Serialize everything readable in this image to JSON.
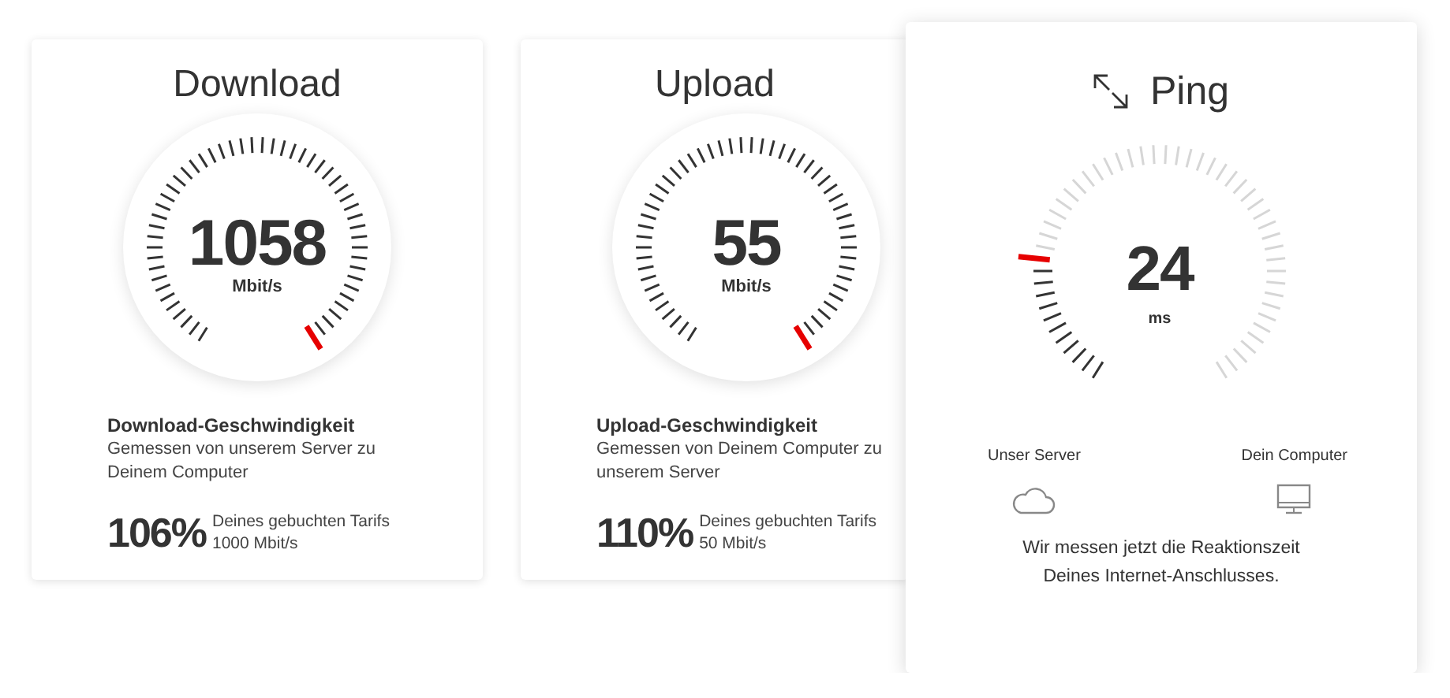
{
  "cards": [
    {
      "kind": "speed",
      "title": "Download",
      "gauge": {
        "value": "1058",
        "unit": "Mbit/s"
      },
      "heading": "Download-Geschwindigkeit",
      "description": "Gemessen von unserem Server zu Deinem Computer",
      "percent": "106%",
      "tariff_label": "Deines gebuchten Tarifs",
      "tariff_speed": "1000 Mbit/s"
    },
    {
      "kind": "speed",
      "title": "Upload",
      "gauge": {
        "value": "55",
        "unit": "Mbit/s"
      },
      "heading": "Upload-Geschwindigkeit",
      "description": "Gemessen von Deinem Computer zu unserem Server",
      "percent": "110%",
      "tariff_label": "Deines gebuchten Tarifs",
      "tariff_speed": "50 Mbit/s"
    },
    {
      "kind": "latency",
      "title": "Ping",
      "gauge": {
        "value": "24",
        "unit": "ms"
      },
      "endpoints": [
        {
          "label": "Unser Server",
          "kind": "cloud"
        },
        {
          "label": "Dein Computer",
          "kind": "computer"
        }
      ],
      "message": "Wir messen jetzt die Reaktionszeit Deines Internet-Anschlusses."
    }
  ]
}
